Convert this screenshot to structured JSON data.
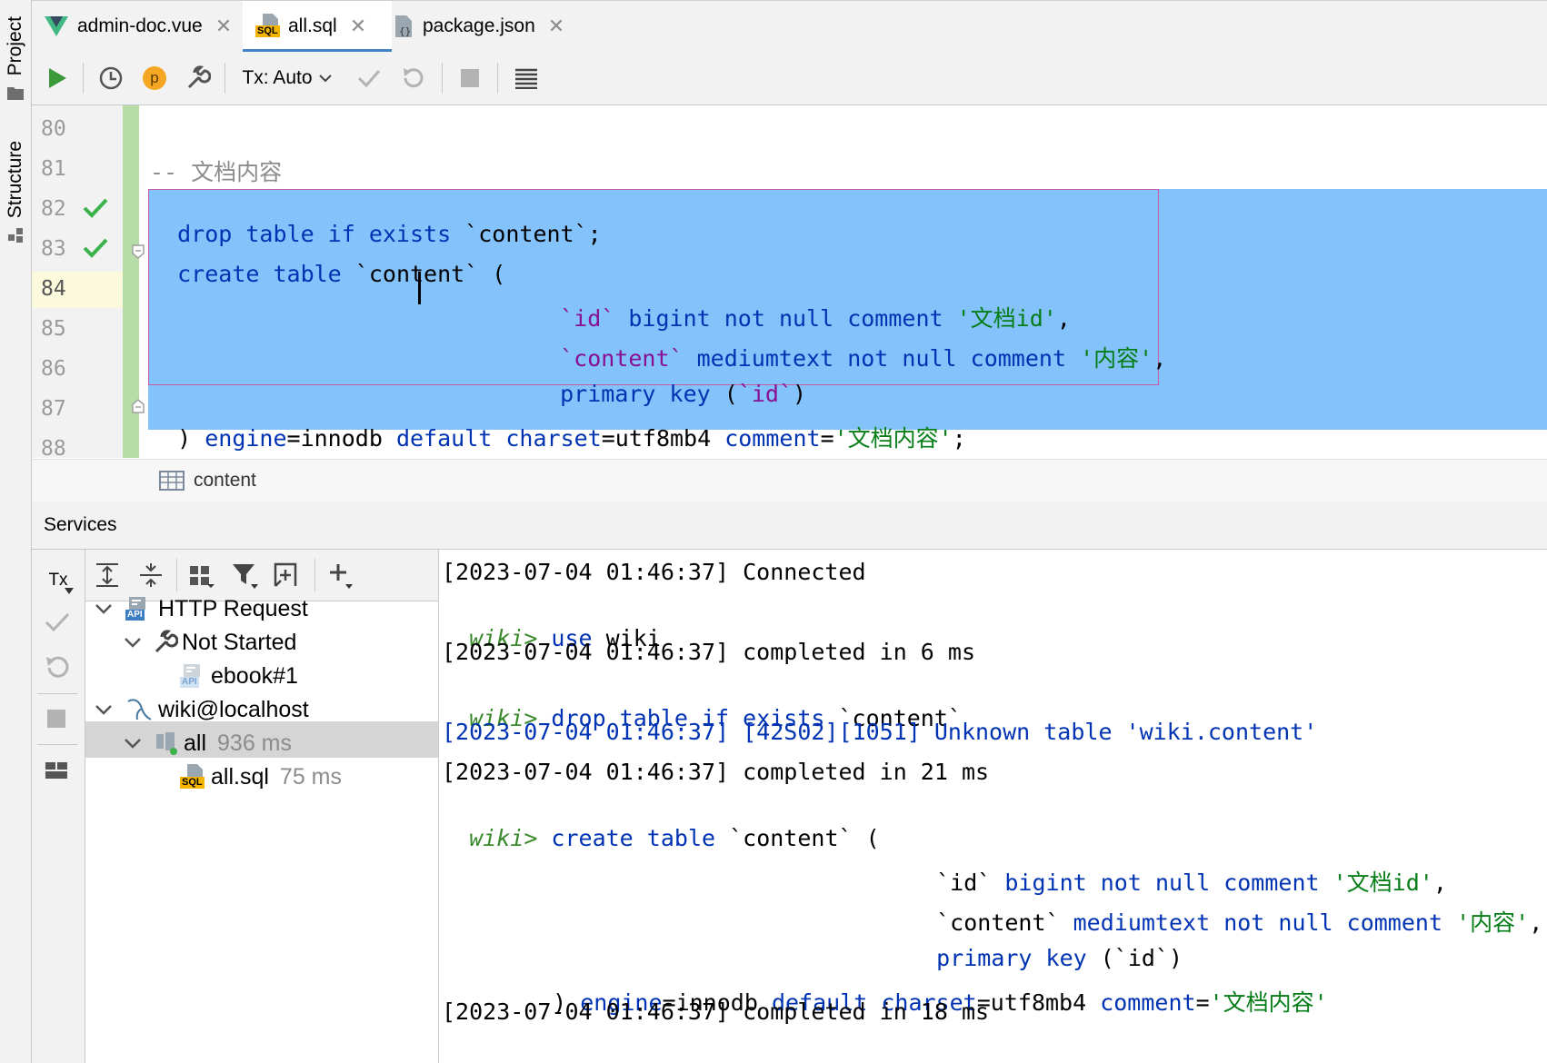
{
  "side_tabs": {
    "project": "Project",
    "structure": "Structure"
  },
  "tabs": [
    {
      "label": "admin-doc.vue",
      "icon": "vue-icon"
    },
    {
      "label": "all.sql",
      "icon": "sql-file-icon",
      "icon_text": "SQL"
    },
    {
      "label": "package.json",
      "icon": "json-file-icon"
    }
  ],
  "toolbar": {
    "tx_label": "Tx: Auto",
    "p_badge": "p"
  },
  "editor": {
    "line_numbers": [
      "80",
      "81",
      "82",
      "83",
      "84",
      "85",
      "86",
      "87",
      "88"
    ],
    "comment_line": "-- 文档内容",
    "l82": {
      "kw": "drop table if exists",
      "rest": " `content`;"
    },
    "l83": {
      "kw": "create table",
      "rest": " `content` ("
    },
    "l84": {
      "id": "`id`",
      "kw1": " bigint not null comment ",
      "str": "'文档id'",
      "tail": ","
    },
    "l85": {
      "id": "`content`",
      "kw1": " mediumtext not null comment ",
      "str": "'内容'",
      "tail": ","
    },
    "l86": {
      "kw": "primary key",
      "open": " (",
      "id": "`id`",
      "close": ")"
    },
    "l87": {
      "open": ") ",
      "k1": "engine",
      "v1": "=innodb ",
      "k2": "default charset",
      "v2": "=utf8mb4 ",
      "k3": "comment",
      "eq": "=",
      "str": "'文档内容'",
      "tail": ";"
    },
    "breadcrumb": "content"
  },
  "services": {
    "title": "Services",
    "tx_button": "Tx",
    "tree": {
      "http_request": "HTTP Request",
      "not_started": "Not Started",
      "ebook": "ebook#1",
      "wiki": "wiki@localhost",
      "all": "all",
      "all_time": "936 ms",
      "all_sql": "all.sql",
      "all_sql_time": "75 ms",
      "api_icon_text": "API"
    },
    "console": {
      "line1": "[2023-07-04 01:46:37] Connected",
      "prompt": "wiki>",
      "use_kw": " use",
      "use_rest": " wiki",
      "line3": "[2023-07-04 01:46:37] completed in 6 ms",
      "drop_kw": " drop table if exists",
      "drop_rest": " `content`",
      "error": "[2023-07-04 01:46:37] [42S02][1051] Unknown table 'wiki.content'",
      "line6": "[2023-07-04 01:46:37] completed in 21 ms",
      "create_kw": " create table",
      "create_rest": " `content` (",
      "c_id": "`id`",
      "c_id_kw": " bigint not null comment ",
      "c_id_str": "'文档id'",
      "c_id_tail": ",",
      "c_content": "`content`",
      "c_content_kw": " mediumtext not null comment ",
      "c_content_str": "'内容'",
      "c_content_tail": ",",
      "c_pk_kw": "primary key",
      "c_pk_rest": " (`id`)",
      "c_end_open": ") ",
      "c_engine": "engine",
      "c_engine_v": "=innodb ",
      "c_default": "default charset",
      "c_charset_v": "=utf8mb4 ",
      "c_comment": "comment",
      "c_eq": "=",
      "c_str": "'文档内容'",
      "line_last": "[2023-07-04 01:46:37] completed in 18 ms"
    }
  }
}
